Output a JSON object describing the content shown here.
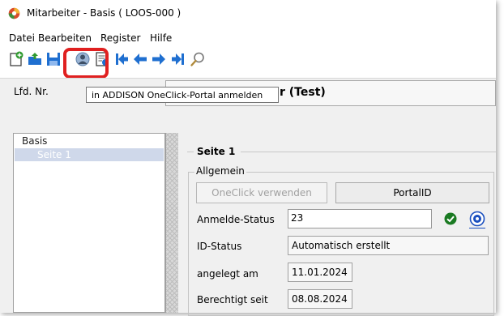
{
  "window": {
    "title": "Mitarbeiter - Basis  ( LOOS-000 )"
  },
  "menu": {
    "items": [
      "Datei",
      "Bearbeiten",
      "Register",
      "Hilfe"
    ]
  },
  "tooltip": {
    "text": "in ADDISON OneClick-Portal anmelden"
  },
  "header": {
    "lfd_label": "Lfd. Nr.",
    "name_value": "r (Test)"
  },
  "tree": {
    "items": [
      {
        "label": "Basis",
        "selected": false
      },
      {
        "label": "Seite 1",
        "selected": true
      }
    ]
  },
  "page": {
    "section_title": "Seite 1",
    "group_title": "Allgemein",
    "oneclick_button": "OneClick verwenden",
    "portal_button": "PortalID",
    "rows": [
      {
        "label": "Anmelde-Status",
        "value": "23"
      },
      {
        "label": "ID-Status",
        "value": "Automatisch erstellt"
      },
      {
        "label": "angelegt am",
        "value": "11.01.2024"
      },
      {
        "label": "Berechtigt seit",
        "value": "08.08.2024"
      }
    ]
  },
  "icons": {
    "toolbar": [
      "new-icon",
      "open-icon",
      "save-icon",
      "oneclick-portal-icon",
      "properties-icon",
      "first-record-icon",
      "previous-record-icon",
      "next-record-icon",
      "last-record-icon",
      "search-icon"
    ],
    "status": [
      "status-ok-icon",
      "help-icon"
    ]
  },
  "colors": {
    "highlight": "#e02020",
    "selection": "#cfd8ea",
    "nav_arrows": "#1f6fd0",
    "ok_green": "#1a7a22",
    "help_blue": "#1a4fbf"
  }
}
